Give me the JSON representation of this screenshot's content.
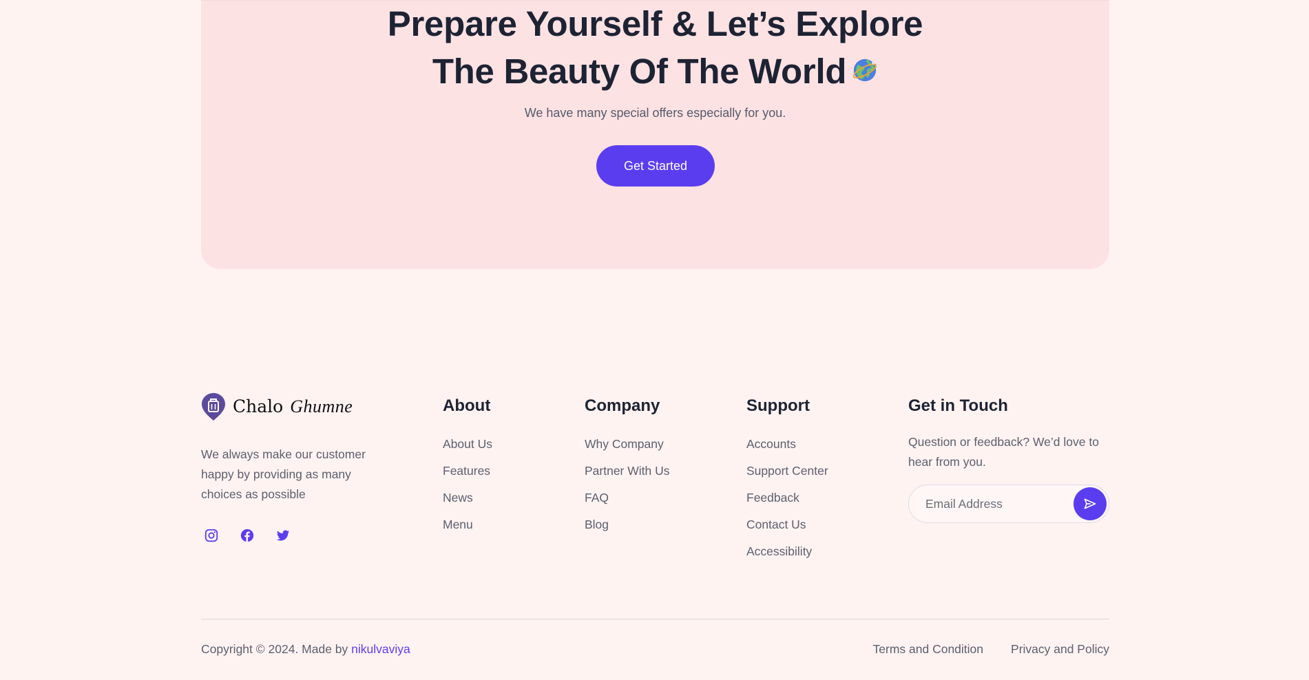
{
  "cta": {
    "title_line1": "Prepare Yourself & Let’s Explore",
    "title_line2": "The Beauty Of The World",
    "subtitle": "We have many special offers especially for you.",
    "button_label": "Get Started"
  },
  "brand": {
    "name": "Chalo",
    "name_script": "Ghumne",
    "description": "We always make our customer happy by providing as many choices as possible"
  },
  "socials": [
    "instagram-icon",
    "facebook-icon",
    "twitter-icon"
  ],
  "about": {
    "heading": "About",
    "links": [
      "About Us",
      "Features",
      "News",
      "Menu"
    ]
  },
  "company": {
    "heading": "Company",
    "links": [
      "Why Company",
      "Partner With Us",
      "FAQ",
      "Blog"
    ]
  },
  "support": {
    "heading": "Support",
    "links": [
      "Accounts",
      "Support Center",
      "Feedback",
      "Contact Us",
      "Accessibility"
    ]
  },
  "contact": {
    "heading": "Get in Touch",
    "text": "Question or feedback? We’d love to hear from you.",
    "email_placeholder": "Email Address"
  },
  "bottom": {
    "copyright_prefix": "Copyright © 2024. Made by ",
    "author": "nikulvaviya",
    "terms": "Terms and Condition",
    "privacy": "Privacy and Policy"
  },
  "colors": {
    "accent": "#5b3df0",
    "banner_bg": "#fde2e3",
    "page_bg": "#fff3f2",
    "heading": "#1d2333",
    "body_text": "#5b5f6c"
  }
}
